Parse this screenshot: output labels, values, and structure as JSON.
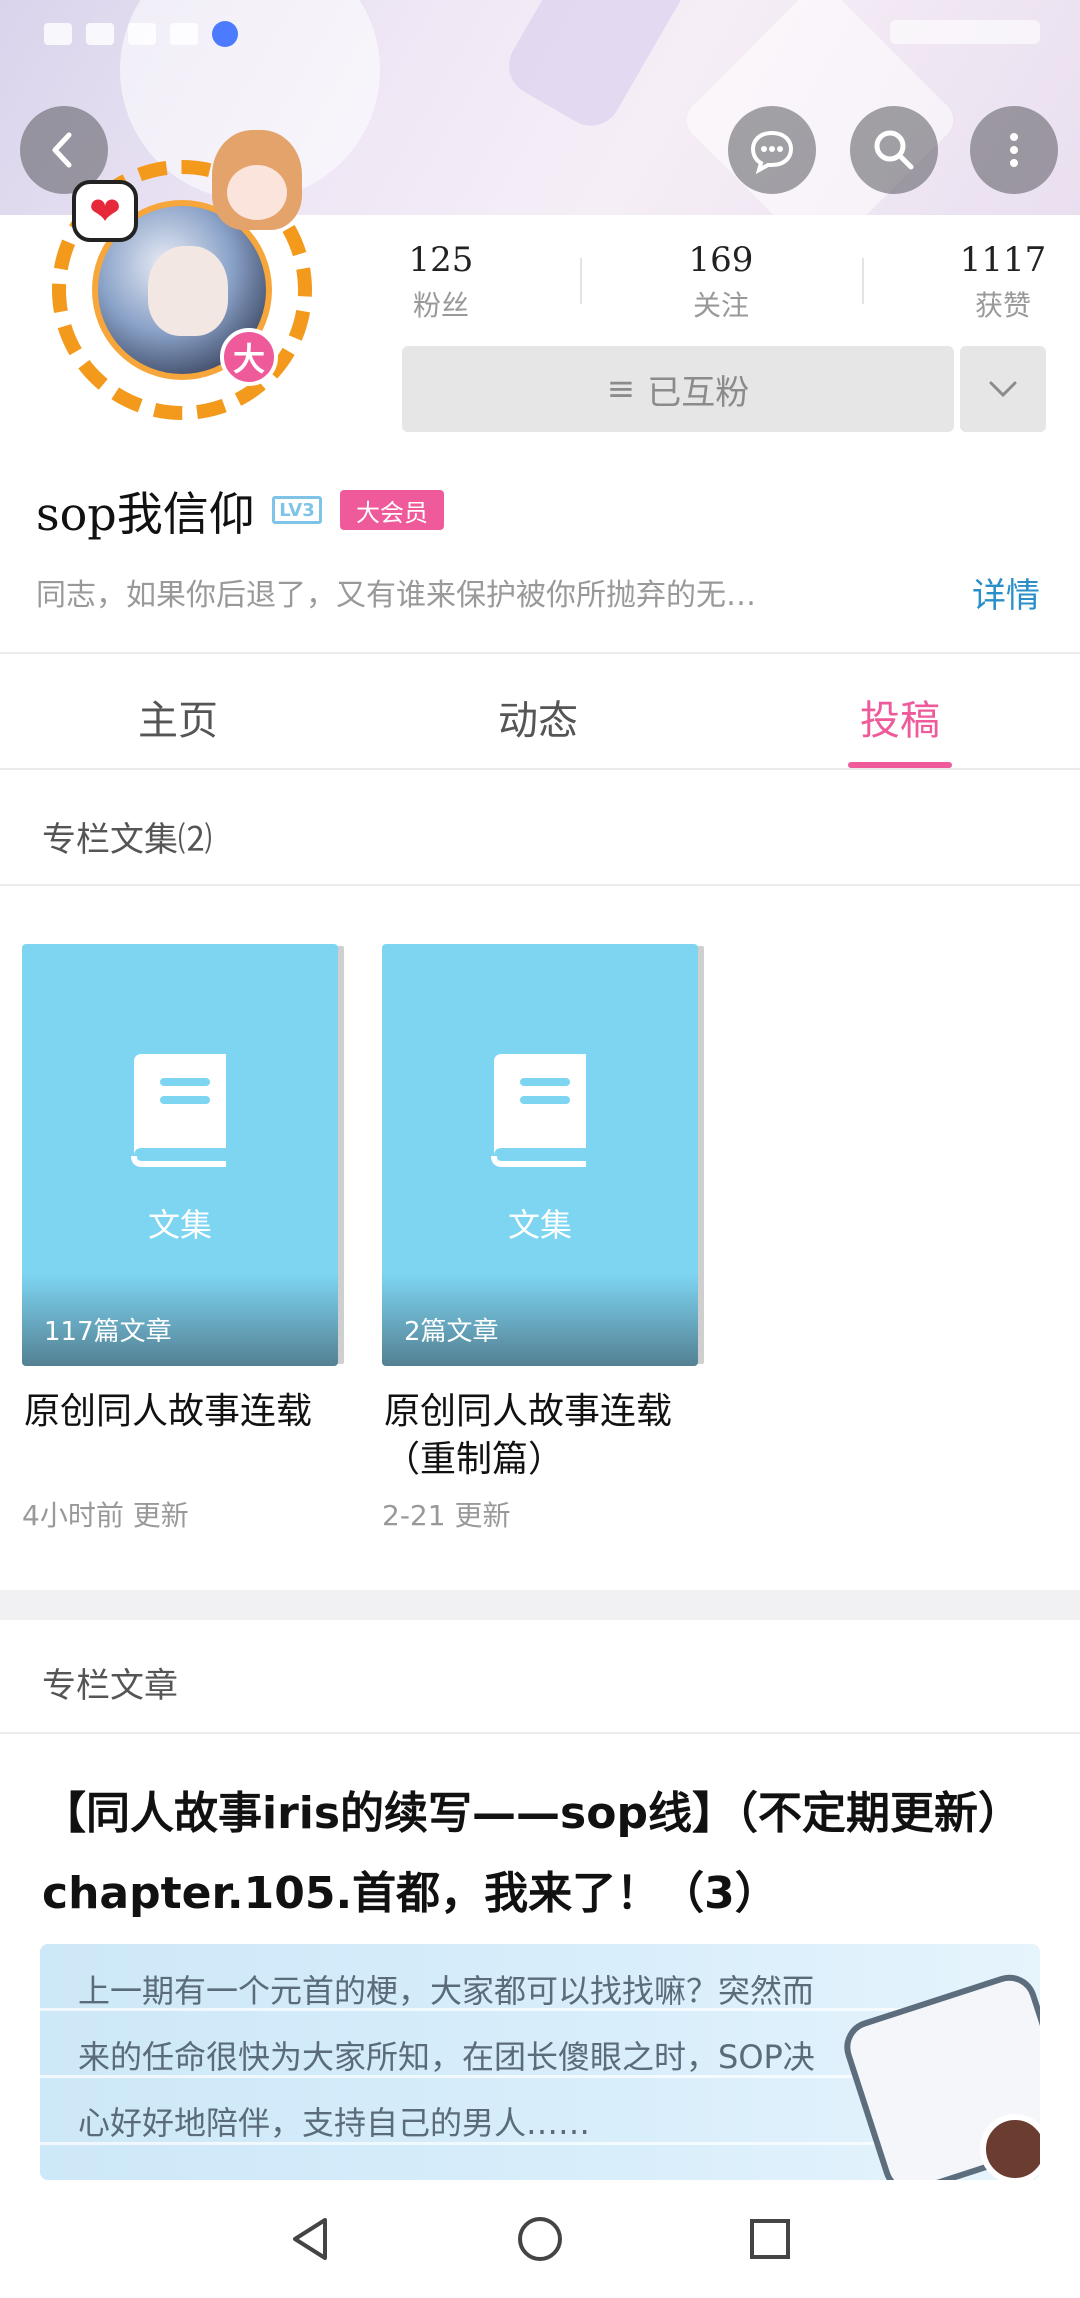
{
  "colors": {
    "accent_pink": "#ee5a9a",
    "link_blue": "#2a8fc9",
    "avatar_ring": "#f39a1c",
    "card_blue": "#7dd5f2"
  },
  "header": {
    "back_icon": "back-arrow-icon",
    "actions": [
      "message-icon",
      "search-icon",
      "more-vertical-icon"
    ]
  },
  "avatar": {
    "heart_badge": "❤",
    "level_badge": "大"
  },
  "stats": [
    {
      "value": "125",
      "label": "粉丝"
    },
    {
      "value": "169",
      "label": "关注"
    },
    {
      "value": "1117",
      "label": "获赞"
    }
  ],
  "follow": {
    "label": "已互粉",
    "icon": "≡",
    "dropdown_icon": "chevron-down-icon"
  },
  "profile": {
    "name": "sop我信仰",
    "level": "LV3",
    "vip": "大会员",
    "bio": "同志，如果你后退了，又有谁来保护被你所抛弃的无…",
    "detail_link": "详情"
  },
  "tabs": [
    {
      "label": "主页",
      "active": false
    },
    {
      "label": "动态",
      "active": false
    },
    {
      "label": "投稿",
      "active": true
    }
  ],
  "collections": {
    "section_title": "专栏文集⑵",
    "items": [
      {
        "label": "文集",
        "count": "117篇文章",
        "title": "原创同人故事连载",
        "updated": "4小时前 更新"
      },
      {
        "label": "文集",
        "count": "2篇文章",
        "title": "原创同人故事连载（重制篇）",
        "updated": "2-21 更新"
      }
    ]
  },
  "articles": {
    "section_title": "专栏文章",
    "first": {
      "title": "【同人故事iris的续写——sop线】（不定期更新）chapter.105.首都，我来了！（3）",
      "summary": "上一期有一个元首的梗，大家都可以找找嘛？突然而来的任命很快为大家所知，在团长傻眼之时，SOP决心好好地陪伴，支持自己的男人……"
    }
  },
  "navbar": [
    "back-triangle-icon",
    "home-circle-icon",
    "recents-square-icon"
  ]
}
